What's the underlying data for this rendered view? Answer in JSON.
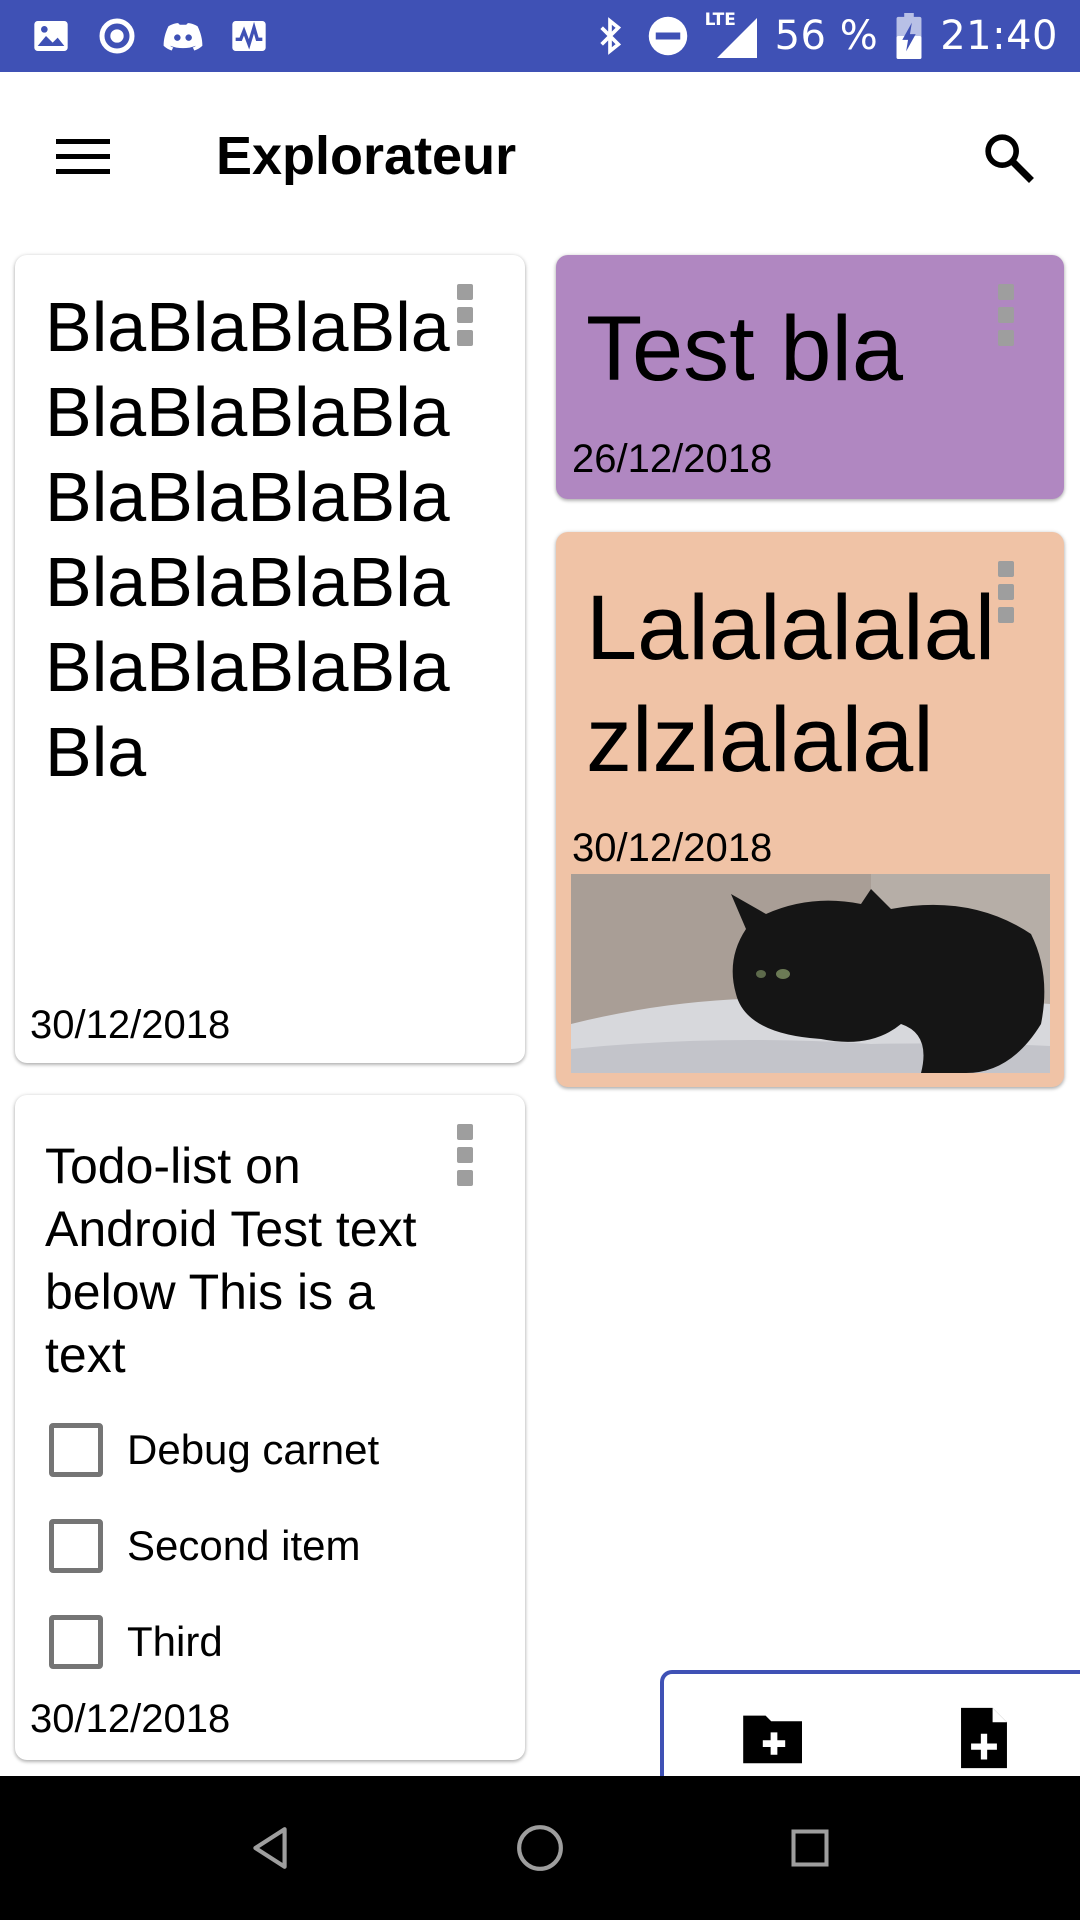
{
  "status_bar": {
    "battery": "56 %",
    "time": "21:40",
    "network": "LTE",
    "left_icons": [
      "image-icon",
      "target-icon",
      "discord-icon",
      "activity-icon"
    ],
    "right_icons": [
      "bluetooth-icon",
      "do-not-disturb-icon",
      "signal-icon",
      "battery-charging-icon"
    ]
  },
  "app_bar": {
    "title": "Explorateur",
    "menu_icon": "hamburger-menu-icon",
    "search_icon": "search-icon"
  },
  "notes": [
    {
      "title": "BlaBlaBlaBlaBlaBlaBlaBlaBlaBlaBlaBlaBlaBlaBlaBlaBlaBlaBlaBlaBla",
      "date": "30/12/2018",
      "color": "#ffffff"
    },
    {
      "title": "Test bla",
      "date": "26/12/2018",
      "color": "#b087c1"
    },
    {
      "title": "Lalalalalalzlzlalalal",
      "date": "30/12/2018",
      "color": "#f0c3a6",
      "image": "black cat photo"
    },
    {
      "title": "Todo-list on Android Test text below This is a text",
      "date": "30/12/2018",
      "color": "#ffffff",
      "todos": [
        {
          "label": "Debug carnet",
          "checked": false
        },
        {
          "label": "Second item",
          "checked": false
        },
        {
          "label": "Third",
          "checked": false
        }
      ]
    }
  ],
  "fab": {
    "icons": [
      "create-folder-icon",
      "create-note-icon"
    ]
  },
  "nav_bar": {
    "icons": [
      "back-icon",
      "home-icon",
      "recents-icon"
    ]
  },
  "colors": {
    "primary": "#3f51b5",
    "nav_background": "#000000",
    "menu_dots": "#9e9e9e"
  }
}
